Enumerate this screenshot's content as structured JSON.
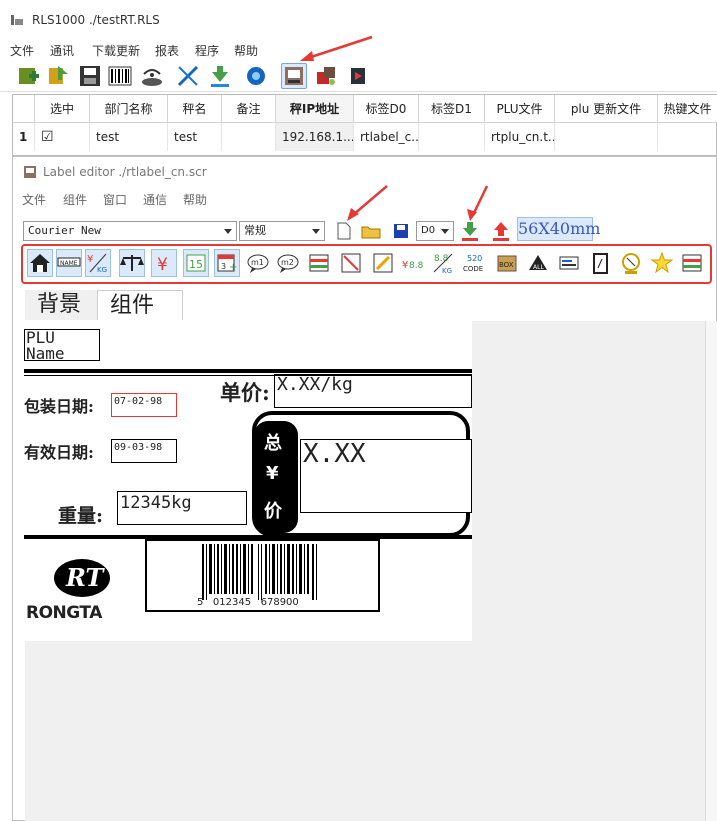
{
  "window": {
    "title": "RLS1000 ./testRT.RLS",
    "menu": [
      "文件",
      "通讯",
      "下载更新",
      "报表",
      "程序",
      "帮助"
    ]
  },
  "grid": {
    "headers": [
      "",
      "选中",
      "部门名称",
      "秤名",
      "备注",
      "秤IP地址",
      "标签D0",
      "标签D1",
      "PLU文件",
      "plu 更新文件",
      "热键文件"
    ],
    "rows": [
      {
        "index": "1",
        "checked": "☑",
        "dept": "test",
        "scale": "test",
        "note": "",
        "ip": "192.168.1....",
        "label_d0": "rtlabel_c...",
        "label_d1": "",
        "plu_file": "rtplu_cn.t...",
        "plu_update": "",
        "hotkey": ""
      }
    ]
  },
  "editor": {
    "title": "Label editor ./rtlabel_cn.scr",
    "menu": [
      "文件",
      "组件",
      "窗口",
      "通信",
      "帮助"
    ],
    "font_family": "Courier New",
    "font_style": "常规",
    "label_slot": "D0",
    "label_size": "56X40mm",
    "tabs": [
      "背景",
      "组件"
    ]
  },
  "label": {
    "plu_text": "PLU Name",
    "pack_date_label": "包装日期:",
    "pack_date_value": "07-02-98",
    "expiry_label": "有效日期:",
    "expiry_value": "09-03-98",
    "weight_label": "重量:",
    "weight_value": "12345kg",
    "unit_price_label": "单价:",
    "unit_price_value": "X.XX/kg",
    "total_label_1": "总",
    "total_label_2": "¥",
    "total_label_3": "价",
    "total_value": "X.XX",
    "barcode_digits": "5   012345   678900",
    "logo_top": "RT",
    "logo_bottom": "RONGTA"
  },
  "component_icons": [
    "home-icon",
    "name-icon",
    "price-per-kg-icon",
    "scale-icon",
    "yen-icon",
    "fifteen-icon",
    "calendar-plus-icon",
    "m1-bubble-icon",
    "m2-bubble-icon",
    "label-card-icon",
    "diagonal-line-icon",
    "pencil-icon",
    "yen-8.8-icon",
    "8.8-kg-icon",
    "520-code-icon",
    "box-icon",
    "all-icon",
    "barcode-card-icon",
    "door-icon",
    "valve-icon",
    "star-icon",
    "label-card-2-icon"
  ],
  "colors": {
    "accent_red": "#e53935",
    "highlight_blue": "#dbeafa",
    "label_black": "#000000"
  }
}
